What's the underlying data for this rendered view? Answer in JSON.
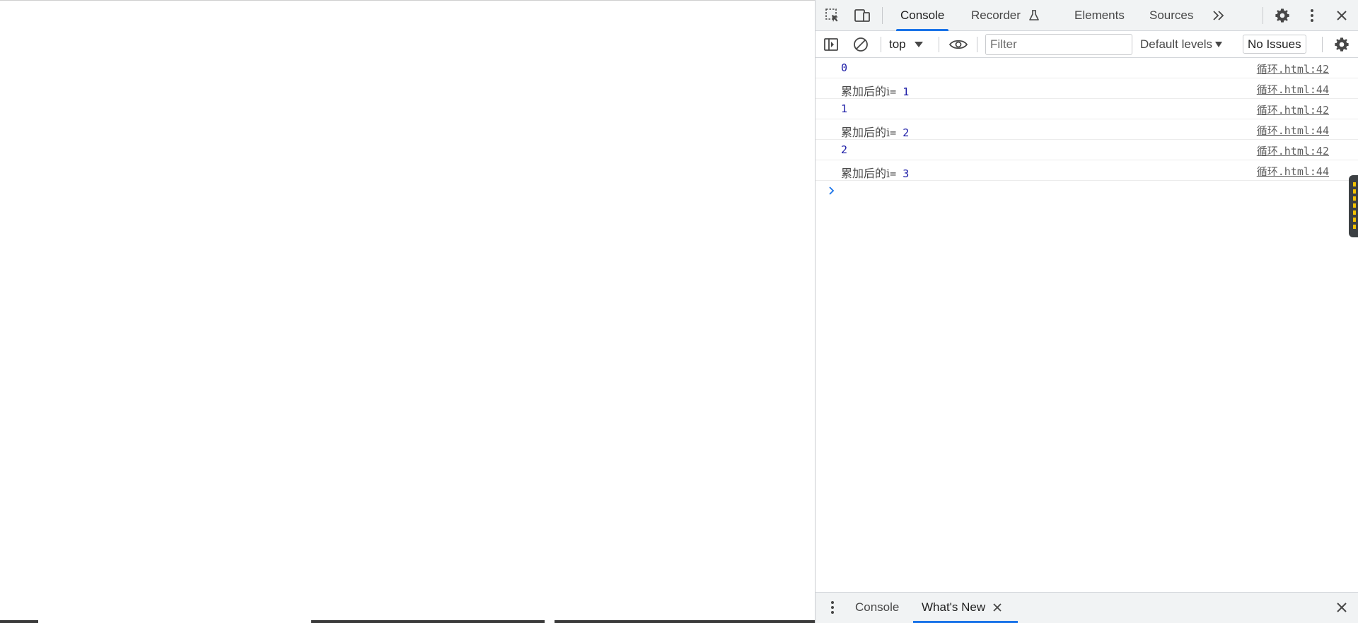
{
  "main_toolbar": {
    "tabs": [
      {
        "label": "Console",
        "active": true
      },
      {
        "label": "Recorder",
        "active": false
      },
      {
        "label": "Elements",
        "active": false
      },
      {
        "label": "Sources",
        "active": false
      }
    ],
    "icons": [
      "inspect-element-icon",
      "device-toolbar-icon",
      "recorder-flask-icon",
      "more-tabs-icon",
      "settings-gear-icon",
      "more-options-icon",
      "close-icon"
    ]
  },
  "console_toolbar": {
    "context": "top",
    "filter_placeholder": "Filter",
    "filter_value": "",
    "levels_label": "Default levels",
    "issues_label": "No Issues"
  },
  "console": {
    "messages": [
      {
        "label": "",
        "value": "0",
        "source": "循环.html:42"
      },
      {
        "label": "累加后的i",
        "value": "1",
        "source": "循环.html:44"
      },
      {
        "label": "",
        "value": "1",
        "source": "循环.html:42"
      },
      {
        "label": "累加后的i",
        "value": "2",
        "source": "循环.html:44"
      },
      {
        "label": "",
        "value": "2",
        "source": "循环.html:42"
      },
      {
        "label": "累加后的i",
        "value": "3",
        "source": "循环.html:44"
      }
    ],
    "eq_sign": "= "
  },
  "drawer": {
    "tabs": [
      {
        "label": "Console",
        "active": false
      },
      {
        "label": "What's New",
        "active": true
      }
    ]
  },
  "colors": {
    "accent": "#1a73e8",
    "number": "#1a1aa6",
    "toolbar_bg": "#f1f3f4"
  }
}
